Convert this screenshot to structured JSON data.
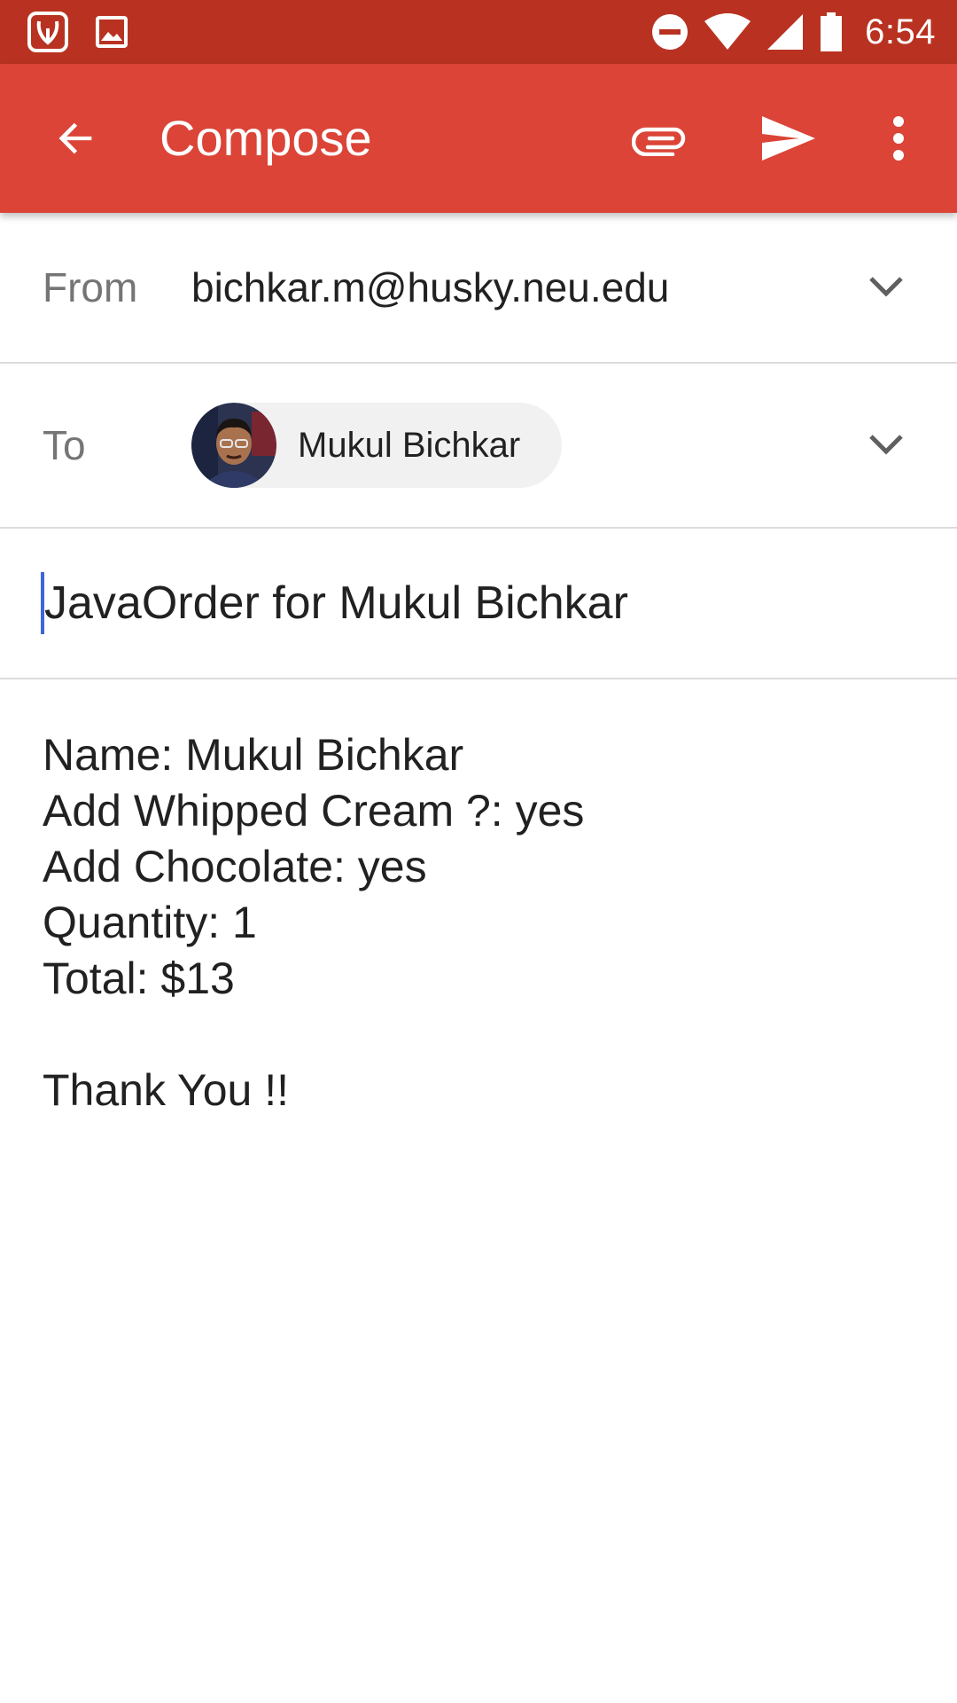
{
  "status_bar": {
    "time": "6:54",
    "icons": [
      "saavn-app-icon",
      "gallery-notification-icon",
      "do-not-disturb-icon",
      "wifi-icon",
      "cell-signal-icon",
      "battery-icon"
    ]
  },
  "app_bar": {
    "title": "Compose",
    "actions": [
      "back-arrow-icon",
      "attach-icon",
      "send-icon",
      "more-vert-icon"
    ],
    "color": "#db4437",
    "status_color": "#b93221"
  },
  "from": {
    "label": "From",
    "value": "bichkar.m@husky.neu.edu"
  },
  "to": {
    "label": "To",
    "recipients": [
      {
        "name": "Mukul Bichkar"
      }
    ]
  },
  "subject": {
    "value": "JavaOrder for Mukul Bichkar"
  },
  "body": {
    "lines": [
      "Name: Mukul Bichkar",
      "Add Whipped Cream ?: yes",
      "Add Chocolate: yes",
      "Quantity: 1",
      "Total: $13"
    ],
    "closing": "Thank You !!"
  }
}
